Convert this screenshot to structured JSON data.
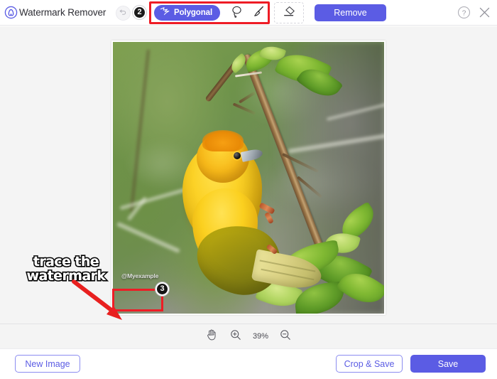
{
  "app": {
    "title": "Watermark Remover",
    "logo_icon": "waterdrop-logo-icon",
    "accent_color": "#5b5ce4",
    "highlight_color": "#ee1c25"
  },
  "toolbar": {
    "undo_icon": "undo-icon",
    "step_badge_2": "2",
    "tools": [
      {
        "id": "polygonal",
        "label": "Polygonal",
        "icon": "polygonal-lasso-icon",
        "active": true
      },
      {
        "id": "lasso",
        "label": "",
        "icon": "lasso-icon",
        "active": false
      },
      {
        "id": "brush",
        "label": "",
        "icon": "brush-icon",
        "active": false
      }
    ],
    "eraser": {
      "label": "",
      "icon": "eraser-icon"
    },
    "remove_label": "Remove",
    "help_icon": "question-mark-icon",
    "close_icon": "close-x-icon"
  },
  "canvas": {
    "image_alt": "yellow weaver bird perched on a branch with green leaves",
    "watermark_text": "@Myexample",
    "step_badge_3": "3",
    "annotation_line1": "trace the",
    "annotation_line2": "watermark",
    "arrow_icon": "red-arrow-icon"
  },
  "zoombar": {
    "pan_icon": "hand-pan-icon",
    "zoom_in_icon": "zoom-in-icon",
    "zoom_level": "39%",
    "zoom_out_icon": "zoom-out-icon"
  },
  "bottombar": {
    "new_image_label": "New Image",
    "crop_save_label": "Crop & Save",
    "save_label": "Save"
  }
}
